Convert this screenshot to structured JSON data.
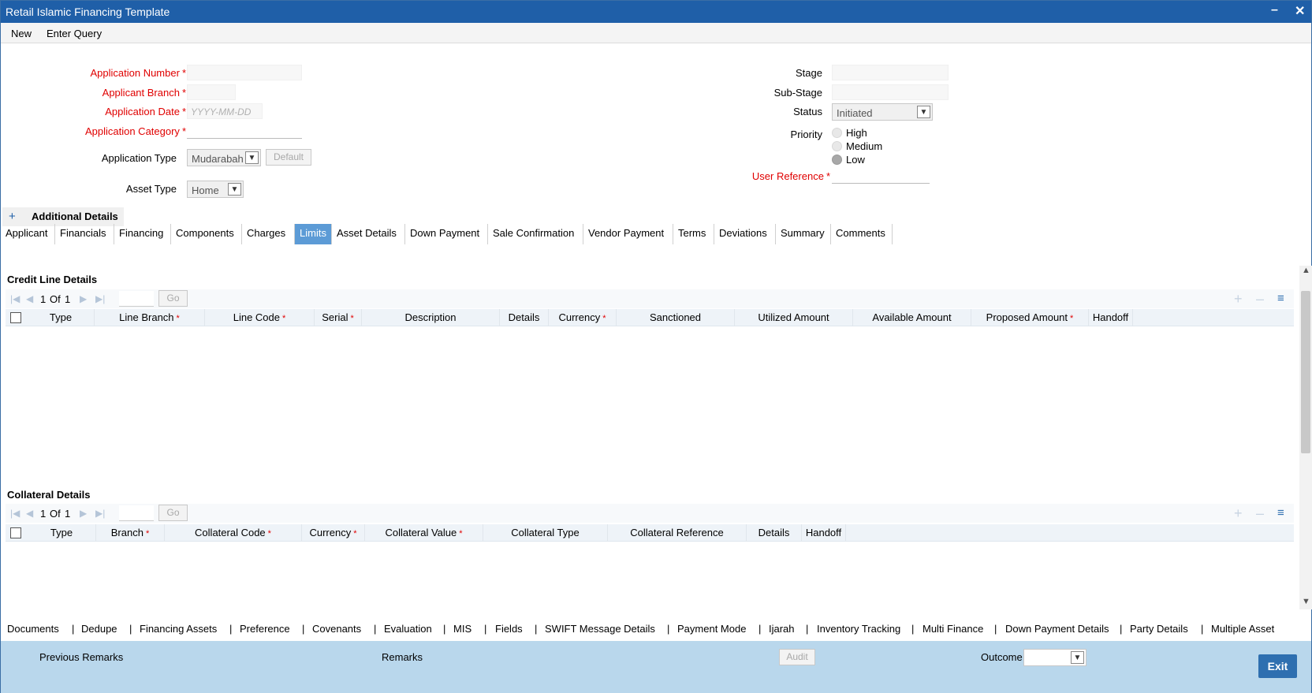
{
  "window": {
    "title": "Retail Islamic Financing Template",
    "minimize": "–",
    "close": "✕"
  },
  "menu": {
    "new": "New",
    "enter_query": "Enter Query"
  },
  "form": {
    "application_number": "Application Number",
    "applicant_branch": "Applicant Branch",
    "application_date": "Application Date",
    "application_date_placeholder": "YYYY-MM-DD",
    "application_category": "Application Category",
    "application_type": "Application Type",
    "application_type_value": "Mudarabah",
    "default_button": "Default",
    "asset_type": "Asset Type",
    "asset_type_value": "Home",
    "required_mark": "*",
    "stage": "Stage",
    "sub_stage": "Sub-Stage",
    "status": "Status",
    "status_value": "Initiated",
    "priority": "Priority",
    "priority_options": [
      "High",
      "Medium",
      "Low"
    ],
    "priority_selected": "Low",
    "user_reference": "User Reference"
  },
  "additional_details": {
    "icon": "+",
    "label": "Additional Details"
  },
  "tabs": [
    "Applicant",
    "Financials",
    "Financing",
    "Components",
    "Charges",
    "Limits",
    "Asset Details",
    "Down Payment",
    "Sale Confirmation",
    "Vendor Payment",
    "Terms",
    "Deviations",
    "Summary",
    "Comments"
  ],
  "active_tab": "Limits",
  "credit_line": {
    "title": "Credit Line Details",
    "pager": {
      "current": "1",
      "of": "Of",
      "total": "1",
      "go": "Go"
    },
    "columns": [
      "Type",
      "Line Branch",
      "Line Code",
      "Serial",
      "Description",
      "Details",
      "Currency",
      "Sanctioned",
      "Utilized Amount",
      "Available Amount",
      "Proposed Amount",
      "Handoff"
    ],
    "required_columns": [
      "Line Branch",
      "Line Code",
      "Serial",
      "Currency",
      "Proposed Amount"
    ]
  },
  "collateral": {
    "title": "Collateral Details",
    "pager": {
      "current": "1",
      "of": "Of",
      "total": "1",
      "go": "Go"
    },
    "columns": [
      "Type",
      "Branch",
      "Collateral Code",
      "Currency",
      "Collateral Value",
      "Collateral Type",
      "Collateral Reference",
      "Details",
      "Handoff"
    ],
    "required_columns": [
      "Branch",
      "Collateral Code",
      "Currency",
      "Collateral Value"
    ]
  },
  "bottom_links": [
    "Documents",
    "Dedupe",
    "Financing Assets",
    "Preference",
    "Covenants",
    "Evaluation",
    "MIS",
    "Fields",
    "SWIFT Message Details",
    "Payment Mode",
    "Ijarah",
    "Inventory Tracking",
    "Multi Finance",
    "Down Payment Details",
    "Party Details",
    "Multiple Asset"
  ],
  "link_separator": "|",
  "footer": {
    "previous_remarks": "Previous Remarks",
    "remarks": "Remarks",
    "audit": "Audit",
    "outcome": "Outcome",
    "exit": "Exit"
  },
  "icons": {
    "first": "first-page-icon",
    "prev": "prev-page-icon",
    "next": "next-page-icon",
    "last": "last-page-icon",
    "add": "add-row-icon",
    "remove": "remove-row-icon",
    "view": "single-view-icon"
  }
}
